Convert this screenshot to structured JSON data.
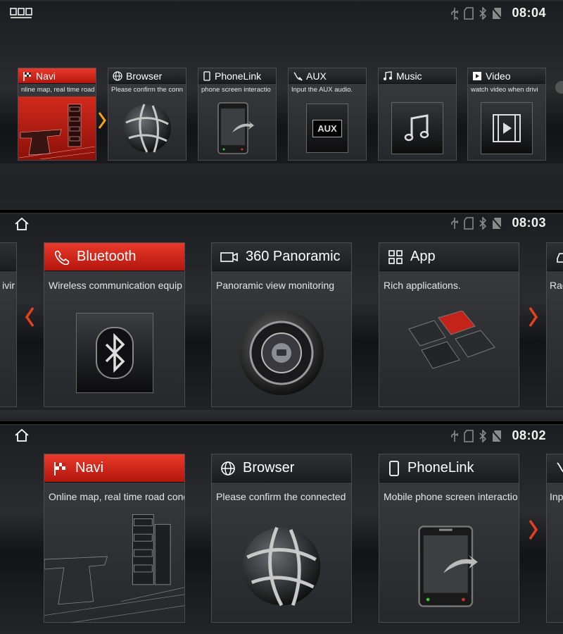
{
  "panel1": {
    "time": "08:04",
    "tiles": [
      {
        "label": "Navi",
        "desc": "nline map, real time road"
      },
      {
        "label": "Browser",
        "desc": "Please confirm the conn"
      },
      {
        "label": "PhoneLink",
        "desc": "phone screen interactio"
      },
      {
        "label": "AUX",
        "desc": "Input the AUX audio."
      },
      {
        "label": "Music",
        "desc": ""
      },
      {
        "label": "Video",
        "desc": "watch video when drivi"
      }
    ],
    "aux_badge": "AUX"
  },
  "panel2": {
    "time": "08:03",
    "left_partial_desc": "ivir",
    "tiles": [
      {
        "label": "Bluetooth",
        "desc": "Wireless communication equip"
      },
      {
        "label": "360 Panoramic",
        "desc": "Panoramic view monitoring"
      },
      {
        "label": "App",
        "desc": "Rich applications."
      }
    ],
    "right_partial_desc": "Rad"
  },
  "panel3": {
    "time": "08:02",
    "tiles": [
      {
        "label": "Navi",
        "desc": "Online map, real time road cond"
      },
      {
        "label": "Browser",
        "desc": "Please confirm the connected"
      },
      {
        "label": "PhoneLink",
        "desc": "Mobile phone screen interactio"
      }
    ],
    "right_partial_desc": "Inp"
  },
  "colors": {
    "accent": "#d8291b",
    "arrow_orange": "#f7a21b",
    "status_icon": "#8a8a8a"
  }
}
